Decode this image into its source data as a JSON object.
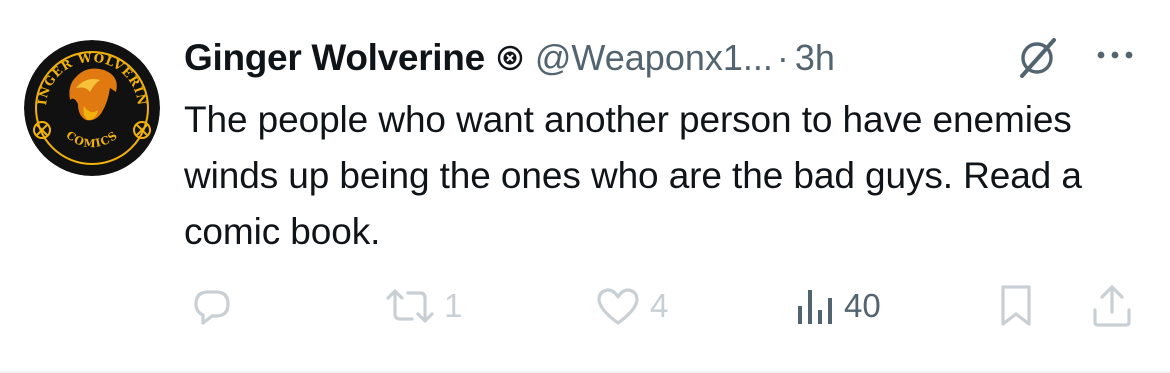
{
  "author": {
    "display_name": "Ginger Wolverine",
    "handle": "@Weaponx1...",
    "separator": "·",
    "time": "3h",
    "avatar": {
      "top_text": "GINGER WOLVERINE",
      "bottom_text": "COMICS",
      "colors": {
        "ring": "#f2b20c",
        "background": "#111111"
      }
    }
  },
  "tweet": {
    "text": "The people who want another person to have enemies winds up being the ones who are the bad guys. Read a comic book."
  },
  "actions": {
    "reply": {
      "icon": "reply-icon",
      "count": ""
    },
    "retweet": {
      "icon": "retweet-icon",
      "count": "1"
    },
    "like": {
      "icon": "heart-icon",
      "count": "4"
    },
    "views": {
      "icon": "views-chart-icon",
      "count": "40"
    },
    "bookmark": {
      "icon": "bookmark-icon"
    },
    "share": {
      "icon": "share-icon"
    }
  },
  "colors": {
    "primary_text": "#0f1419",
    "secondary_text": "#536471",
    "faded_icon": "#c8d0d6"
  }
}
